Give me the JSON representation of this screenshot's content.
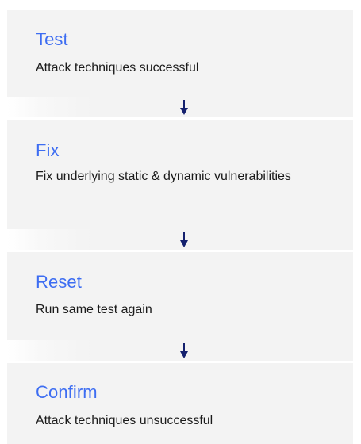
{
  "steps": [
    {
      "title": "Test",
      "description": "Attack techniques successful"
    },
    {
      "title": "Fix",
      "description": "Fix underlying static & dynamic vulnerabilities"
    },
    {
      "title": "Reset",
      "description": "Run same test again"
    },
    {
      "title": "Confirm",
      "description": "Attack techniques unsuccessful"
    }
  ],
  "colors": {
    "title": "#3d6df2",
    "card_background": "#f3f3f3",
    "arrow": "#14206e",
    "description": "#1a1a1a"
  },
  "connectors": [
    {
      "icon": "arrow-down-icon"
    },
    {
      "icon": "arrow-down-icon"
    },
    {
      "icon": "arrow-down-icon"
    }
  ]
}
